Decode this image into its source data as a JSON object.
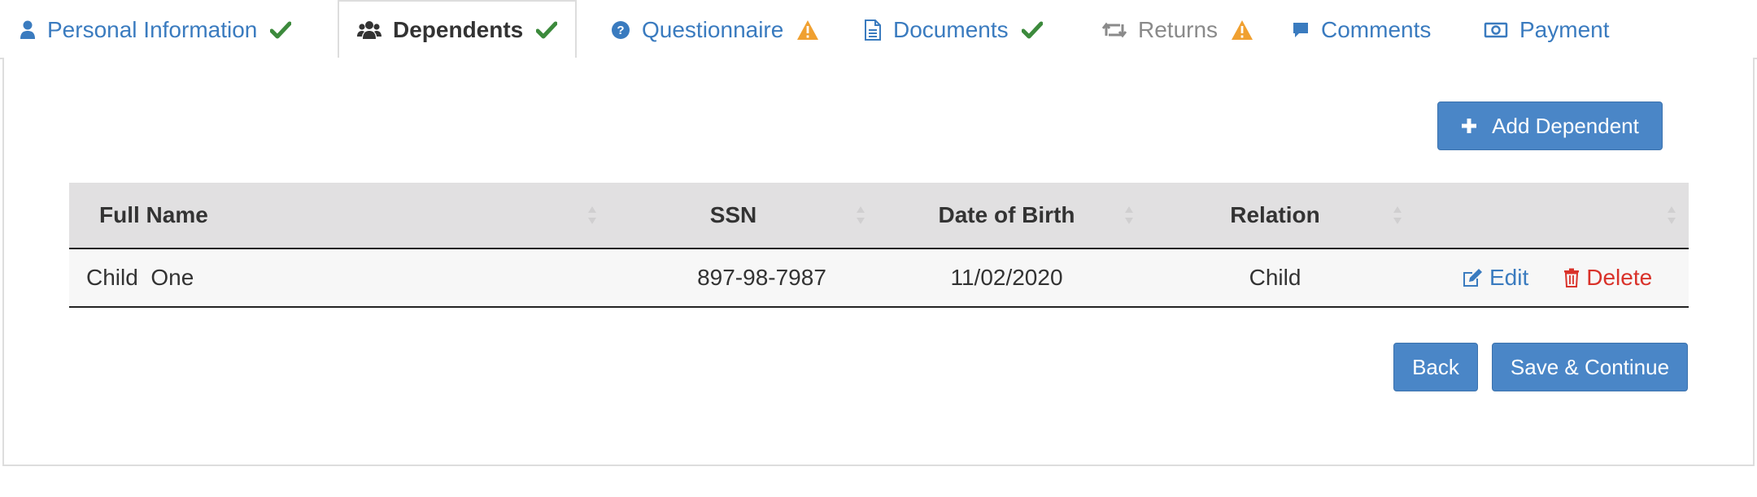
{
  "tabs": [
    {
      "label": "Personal Information",
      "icon": "user-icon",
      "status": "check"
    },
    {
      "label": "Dependents",
      "icon": "users-icon",
      "status": "check"
    },
    {
      "label": "Questionnaire",
      "icon": "question-circle-icon",
      "status": "warning"
    },
    {
      "label": "Documents",
      "icon": "document-icon",
      "status": "check"
    },
    {
      "label": "Returns",
      "icon": "retweet-icon",
      "status": "warning"
    },
    {
      "label": "Comments",
      "icon": "comment-icon",
      "status": ""
    },
    {
      "label": "Payment",
      "icon": "money-icon",
      "status": ""
    }
  ],
  "active_tab": "Dependents",
  "actions": {
    "add_dependent": "Add Dependent",
    "back": "Back",
    "save_continue": "Save & Continue"
  },
  "table": {
    "columns": [
      "Full Name",
      "SSN",
      "Date of Birth",
      "Relation"
    ],
    "rows": [
      {
        "full_name": "Child  One",
        "ssn": "897-98-7987",
        "dob": "11/02/2020",
        "relation": "Child",
        "edit": "Edit",
        "delete": "Delete"
      }
    ]
  },
  "colors": {
    "link": "#3a7bbf",
    "check": "#3c8a3c",
    "warning": "#f0a030",
    "delete": "#d9322a",
    "button": "#4a86c7"
  }
}
